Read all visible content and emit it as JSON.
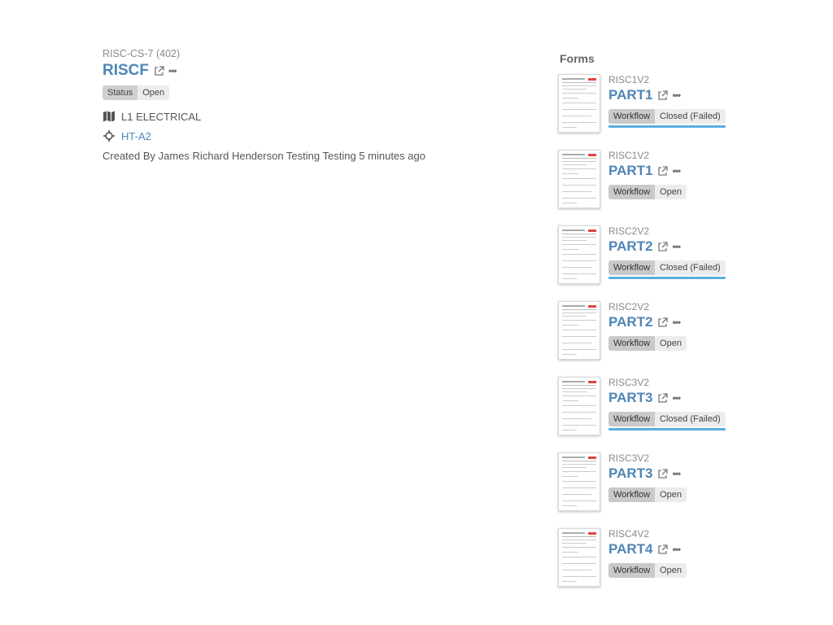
{
  "record": {
    "ref": "RISC-CS-7 (402)",
    "title": "RISCF",
    "status_key": "Status",
    "status_value": "Open",
    "location": "L1 ELECTRICAL",
    "position": "HT-A2",
    "created": "Created By James Richard Henderson Testing Testing 5 minutes ago"
  },
  "forms": {
    "heading": "Forms",
    "workflow_key": "Workflow",
    "items": [
      {
        "code": "RISC1V2",
        "title": "PART1",
        "status": "Closed (Failed)",
        "failed": true
      },
      {
        "code": "RISC1V2",
        "title": "PART1",
        "status": "Open",
        "failed": false
      },
      {
        "code": "RISC2V2",
        "title": "PART2",
        "status": "Closed (Failed)",
        "failed": true
      },
      {
        "code": "RISC2V2",
        "title": "PART2",
        "status": "Open",
        "failed": false
      },
      {
        "code": "RISC3V2",
        "title": "PART3",
        "status": "Closed (Failed)",
        "failed": true
      },
      {
        "code": "RISC3V2",
        "title": "PART3",
        "status": "Open",
        "failed": false
      },
      {
        "code": "RISC4V2",
        "title": "PART4",
        "status": "Open",
        "failed": false
      }
    ]
  },
  "colors": {
    "link": "#4f86b6",
    "failed_underline": "#5aaee0"
  },
  "icons": {
    "external": "external-link-icon",
    "more": "ellipsis-icon",
    "location": "map-icon",
    "position": "crosshair-icon"
  }
}
